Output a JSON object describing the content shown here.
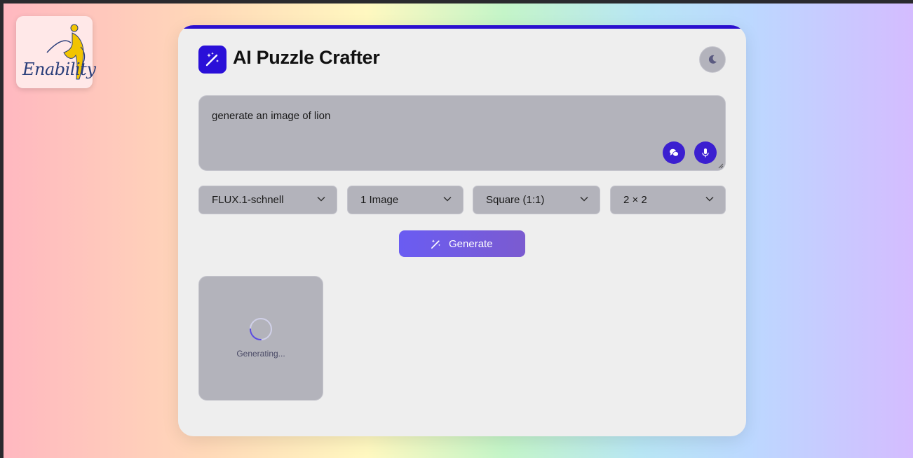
{
  "logo": {
    "text": "Enability"
  },
  "header": {
    "title": "AI Puzzle Crafter",
    "app_icon": "magic-wand-icon",
    "theme_toggle_icon": "moon-icon"
  },
  "prompt": {
    "value": "generate an image of lion",
    "buttons": [
      {
        "name": "chat-bubbles-icon"
      },
      {
        "name": "microphone-icon"
      }
    ]
  },
  "options": {
    "model": "FLUX.1-schnell",
    "count": "1 Image",
    "aspect": "Square (1:1)",
    "grid": "2 × 2"
  },
  "generate": {
    "label": "Generate",
    "icon": "magic-wand-icon"
  },
  "results": [
    {
      "status": "Generating..."
    }
  ],
  "colors": {
    "accent": "#2a10d8",
    "button_gradient_start": "#6a5cf2",
    "button_gradient_end": "#7b5bd0",
    "card_bg": "#eeeeee",
    "field_bg": "#b3b3bb"
  }
}
